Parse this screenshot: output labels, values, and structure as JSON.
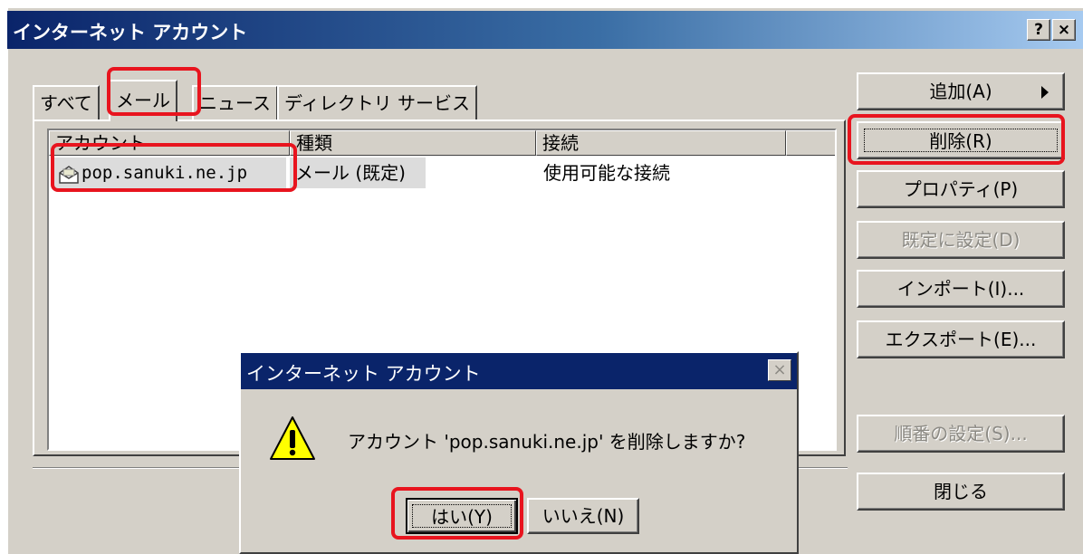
{
  "window": {
    "title": "インターネット アカウント",
    "help_label": "?",
    "close_label": "×"
  },
  "tabs": [
    {
      "label": "すべて",
      "active": false
    },
    {
      "label": "メール",
      "active": true
    },
    {
      "label": "ニュース",
      "active": false
    },
    {
      "label": "ディレクトリ サービス",
      "active": false
    }
  ],
  "list": {
    "columns": [
      "アカウント",
      "種類",
      "接続"
    ],
    "rows": [
      {
        "account": "pop.sanuki.ne.jp",
        "type": "メール (既定)",
        "connection": "使用可能な接続",
        "icon": "mail-account-icon"
      }
    ]
  },
  "buttons": {
    "add": "追加(A)",
    "delete": "削除(R)",
    "properties": "プロパティ(P)",
    "set_default": "既定に設定(D)",
    "import": "インポート(I)...",
    "export": "エクスポート(E)...",
    "order": "順番の設定(S)...",
    "close": "閉じる"
  },
  "dialog": {
    "title": "インターネット アカウント",
    "message": "アカウント 'pop.sanuki.ne.jp' を削除しますか?",
    "yes": "はい(Y)",
    "no": "いいえ(N)",
    "icon": "warning-icon"
  },
  "colors": {
    "highlight": "#e8141e",
    "titlebar": "#0a246a",
    "face": "#d4d0c8"
  }
}
